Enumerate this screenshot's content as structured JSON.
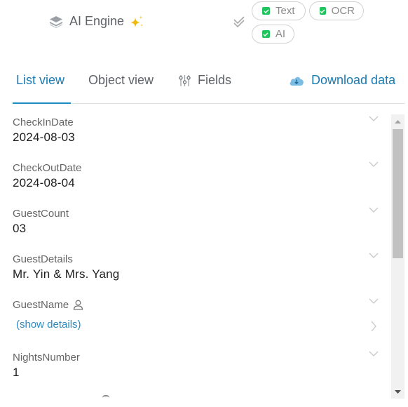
{
  "engine": {
    "label": "AI Engine",
    "icon": "layers-icon",
    "badge_icon": "sparkle-icon"
  },
  "options": {
    "select_all_icon": "double-check-icon",
    "chips": [
      {
        "label": "Text",
        "checked": true
      },
      {
        "label": "OCR",
        "checked": true
      },
      {
        "label": "AI",
        "checked": true
      }
    ]
  },
  "tabs": {
    "items": [
      {
        "label": "List view",
        "active": true
      },
      {
        "label": "Object view",
        "active": false
      },
      {
        "label": "Fields",
        "active": false,
        "icon": "sliders-icon"
      }
    ],
    "download_label": "Download data",
    "download_icon": "cloud-download-icon"
  },
  "fields": [
    {
      "name": "CheckInDate",
      "value": "2024-08-03"
    },
    {
      "name": "CheckOutDate",
      "value": "2024-08-04"
    },
    {
      "name": "GuestCount",
      "value": "03"
    },
    {
      "name": "GuestDetails",
      "value": "Mr. Yin & Mrs. Yang"
    },
    {
      "name": "GuestName",
      "icon": "person-icon",
      "link": "(show details)"
    },
    {
      "name": "NightsNumber",
      "value": "1"
    }
  ],
  "colors": {
    "accent": "#1a7bb5",
    "chip_check": "#21c55d",
    "sparkle": "#f0b90b"
  }
}
